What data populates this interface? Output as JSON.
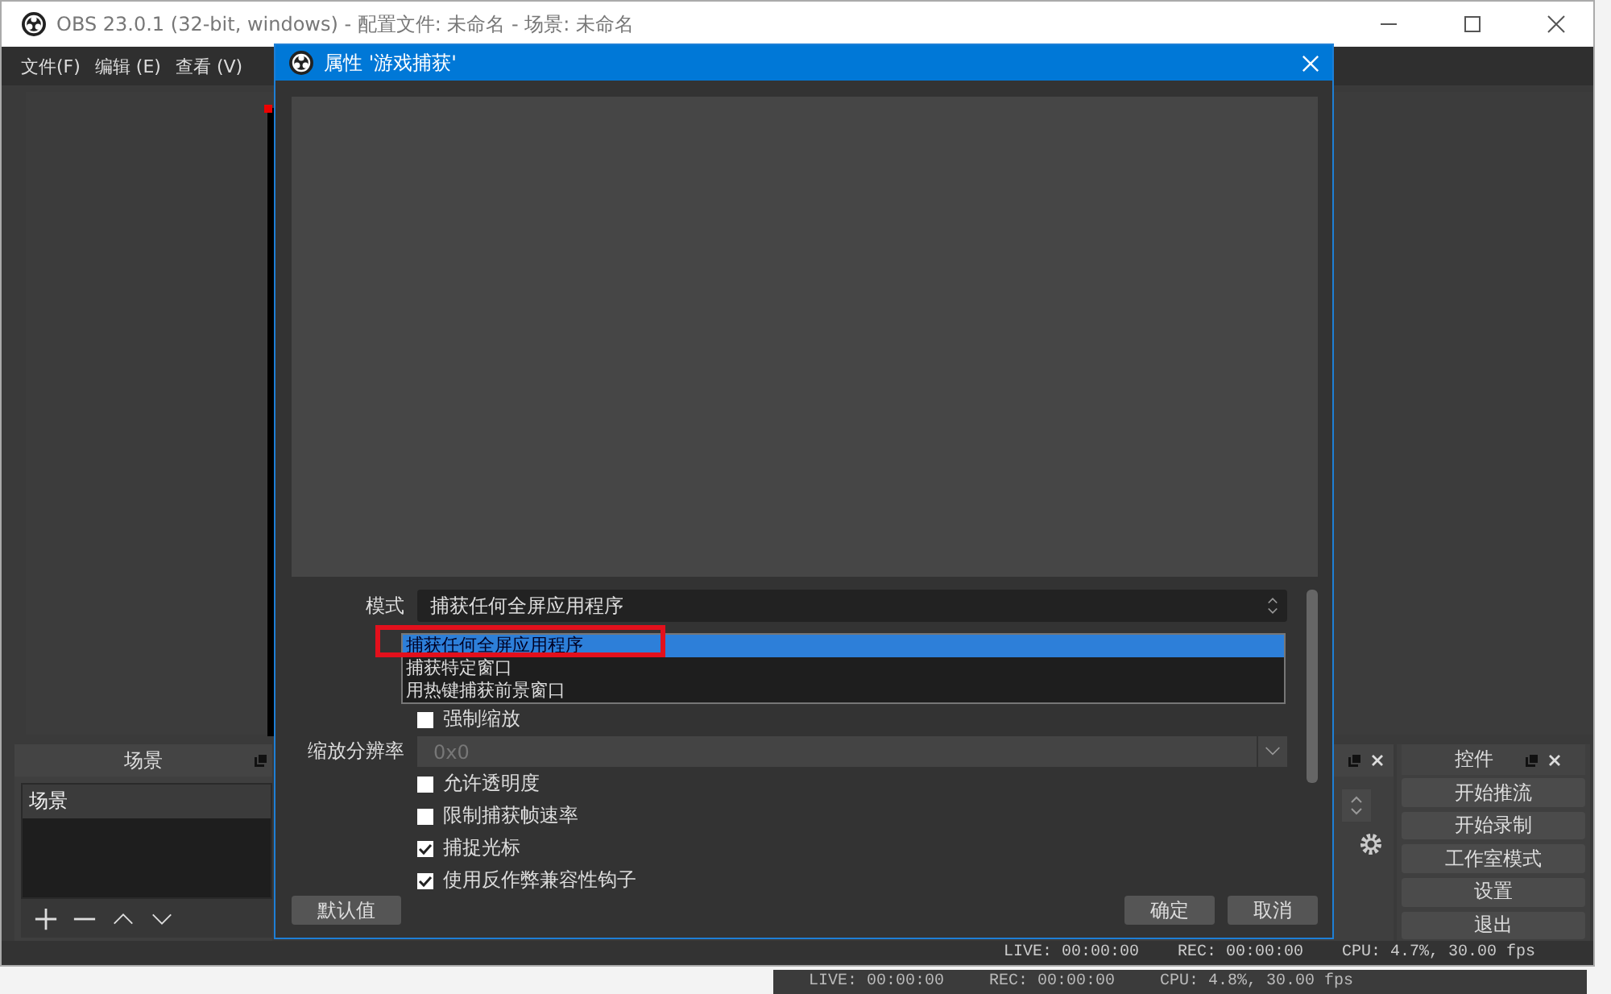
{
  "window": {
    "title": "OBS 23.0.1 (32-bit, windows) - 配置文件: 未命名 - 场景: 未命名"
  },
  "menu": [
    "文件(F)",
    "编辑 (E)",
    "查看 (V)"
  ],
  "scenes_dock": {
    "title": "场景",
    "items": [
      {
        "label": "场景",
        "selected": true
      }
    ]
  },
  "controls_dock": {
    "title": "控件",
    "buttons": [
      "开始推流",
      "开始录制",
      "工作室模式",
      "设置",
      "退出"
    ]
  },
  "status_bar": {
    "live": "LIVE: 00:00:00",
    "rec": "REC: 00:00:00",
    "cpu": "CPU: 4.7%, 30.00 fps"
  },
  "background_status": {
    "live": "LIVE: 00:00:00",
    "rec": "REC: 00:00:00",
    "cpu": "CPU: 4.8%, 30.00 fps"
  },
  "dialog": {
    "title": "属性 '游戏捕获'",
    "mode": {
      "label": "模式",
      "value": "捕获任何全屏应用程序",
      "options": [
        {
          "label": "捕获任何全屏应用程序",
          "selected": true
        },
        {
          "label": "捕获特定窗口",
          "selected": false
        },
        {
          "label": "用热键捕获前景窗口",
          "selected": false
        }
      ]
    },
    "force_scale": {
      "label": "强制缩放",
      "checked": false
    },
    "scale": {
      "label": "缩放分辨率",
      "value": "0x0",
      "disabled": true
    },
    "options": [
      {
        "label": "允许透明度",
        "checked": false
      },
      {
        "label": "限制捕获帧速率",
        "checked": false
      },
      {
        "label": "捕捉光标",
        "checked": true
      },
      {
        "label": "使用反作弊兼容性钩子",
        "checked": true
      }
    ],
    "buttons": {
      "defaults": "默认值",
      "ok": "确定",
      "cancel": "取消"
    }
  }
}
